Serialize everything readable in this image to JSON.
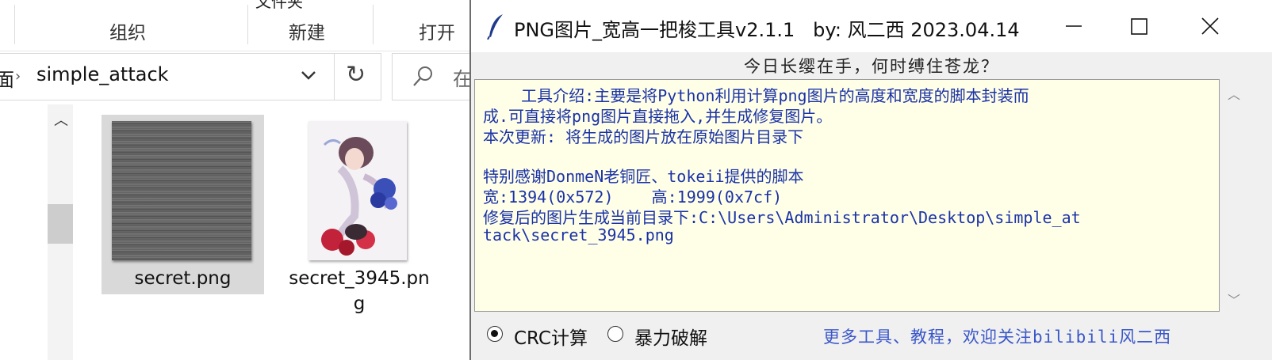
{
  "explorer": {
    "ribbon_top_label": "文件夹",
    "ribbon_groups": [
      "组织",
      "新建",
      "打开"
    ],
    "breadcrumb_prefix": "面",
    "breadcrumb_current": "simple_attack",
    "search_placeholder": "在",
    "files": [
      {
        "name": "secret.png",
        "selected": true
      },
      {
        "name_line1": "secret_3945.pn",
        "name_line2": "g",
        "selected": false
      }
    ]
  },
  "tool": {
    "title": "PNG图片_宽高一把梭工具v2.1.1   by: 风二西 2023.04.14",
    "motto": "今日长缨在手，何时缚住苍龙？",
    "output_lines": [
      "    工具介绍:主要是将Python利用计算png图片的高度和宽度的脚本封装而",
      "成.可直接将png图片直接拖入,并生成修复图片。",
      "本次更新: 将生成的图片放在原始图片目录下",
      "",
      "特别感谢DonmeN老铜匠、tokeii提供的脚本",
      "宽:1394(0x572)    高:1999(0x7cf)",
      "修复后的图片生成当前目录下:C:\\Users\\Administrator\\Desktop\\simple_at",
      "tack\\secret_3945.png"
    ],
    "radio_crc": "CRC计算",
    "radio_brute": "暴力破解",
    "selected_mode": "CRC计算",
    "footer": "更多工具、教程，欢迎关注bilibili风二西",
    "colors": {
      "text_area_bg": "#ffffe7",
      "text_color": "#1a32a8",
      "footer_color": "#3b57c9"
    }
  }
}
